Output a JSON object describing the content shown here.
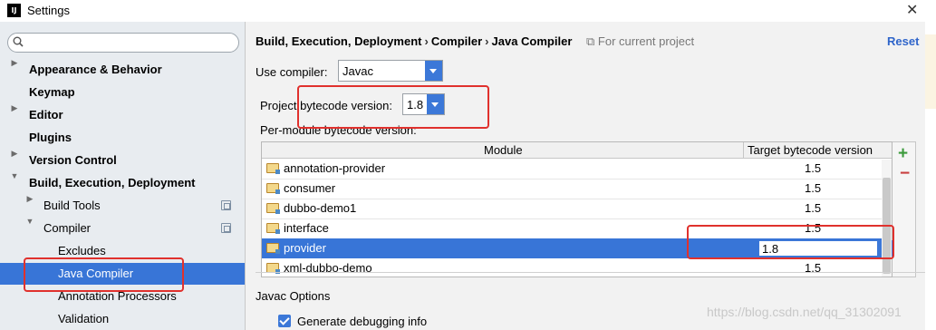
{
  "window": {
    "title": "Settings",
    "app_icon": "IJ"
  },
  "sidebar": {
    "search": {
      "placeholder": ""
    },
    "items": [
      {
        "label": "Appearance & Behavior",
        "bold": true,
        "arrow": "right"
      },
      {
        "label": "Keymap",
        "bold": true
      },
      {
        "label": "Editor",
        "bold": true,
        "arrow": "right"
      },
      {
        "label": "Plugins",
        "bold": true
      },
      {
        "label": "Version Control",
        "bold": true,
        "arrow": "right"
      },
      {
        "label": "Build, Execution, Deployment",
        "bold": true,
        "arrow": "down"
      },
      {
        "label": "Build Tools",
        "arrow": "right"
      },
      {
        "label": "Compiler",
        "arrow": "down"
      },
      {
        "label": "Excludes"
      },
      {
        "label": "Java Compiler",
        "selected": true
      },
      {
        "label": "Annotation Processors"
      },
      {
        "label": "Validation"
      }
    ]
  },
  "main": {
    "breadcrumb": [
      "Build, Execution, Deployment",
      "Compiler",
      "Java Compiler"
    ],
    "breadcrumb_sep": "›",
    "for_project": "For current project",
    "reset": "Reset",
    "use_compiler_label": "Use compiler:",
    "use_compiler_value": "Javac",
    "project_bytecode_label": "Project bytecode version:",
    "project_bytecode_value": "1.8",
    "per_module_label": "Per-module bytecode version:",
    "table": {
      "headers": [
        "Module",
        "Target bytecode version"
      ],
      "rows": [
        {
          "module": "annotation-provider",
          "target": "1.5"
        },
        {
          "module": "consumer",
          "target": "1.5"
        },
        {
          "module": "dubbo-demo1",
          "target": "1.5"
        },
        {
          "module": "interface",
          "target": "1.5"
        },
        {
          "module": "provider",
          "target": "1.8",
          "selected": true,
          "editing": true
        },
        {
          "module": "xml-dubbo-demo",
          "target": "1.5"
        }
      ]
    },
    "add_icon": "+",
    "remove_icon": "−",
    "javac_options_label": "Javac Options",
    "generate_debug_label": "Generate debugging info",
    "generate_debug_checked": true
  },
  "watermark": "https://blog.csdn.net/qq_31302091",
  "colors": {
    "accent": "#3875d7",
    "highlight": "#e0312d"
  }
}
